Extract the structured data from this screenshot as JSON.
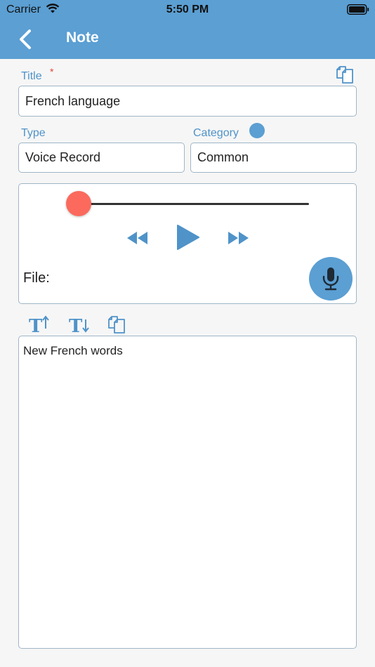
{
  "status": {
    "carrier": "Carrier",
    "time": "5:50 PM"
  },
  "nav": {
    "title": "Note",
    "back_icon": "chevron-left-icon"
  },
  "form": {
    "title_label": "Title",
    "required_mark": "*",
    "title_value": "French language",
    "type_label": "Type",
    "type_value": "Voice Record",
    "category_label": "Category",
    "category_value": "Common",
    "category_color": "#5b9fd3"
  },
  "player": {
    "progress": 0.0,
    "file_label": "File:",
    "thumb_color": "#fb6a5c"
  },
  "note": {
    "text": "New French words"
  },
  "colors": {
    "accent": "#5b9fd3",
    "label": "#4f93c9",
    "required": "#e2483d",
    "background": "#f6f6f6"
  }
}
